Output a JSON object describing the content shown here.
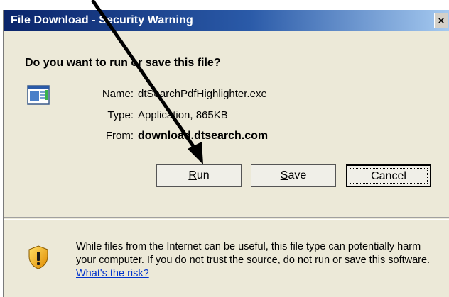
{
  "window": {
    "title": "File Download - Security Warning",
    "close_label": "×"
  },
  "dialog": {
    "question": "Do you want to run or save this file?",
    "fields": [
      {
        "label": "Name:",
        "value": "dtSearchPdfHighlighter.exe"
      },
      {
        "label": "Type:",
        "value": "Application, 865KB"
      },
      {
        "label": "From:",
        "value": "download.dtsearch.com"
      }
    ]
  },
  "buttons": {
    "run": {
      "mnemonic": "R",
      "rest": "un"
    },
    "save": {
      "mnemonic": "S",
      "rest": "ave"
    },
    "cancel": "Cancel"
  },
  "warning": {
    "text": "While files from the Internet can be useful, this file type can potentially harm your computer. If you do not trust the source, do not run or save this software.",
    "link": "What's the risk?"
  },
  "colors": {
    "dialog_bg": "#ece9d8",
    "titlebar_start": "#0a246a",
    "titlebar_end": "#a6caf0",
    "link": "#0033cc"
  },
  "icons": [
    "file-icon",
    "shield-warning-icon",
    "close-icon",
    "annotation-arrow"
  ]
}
